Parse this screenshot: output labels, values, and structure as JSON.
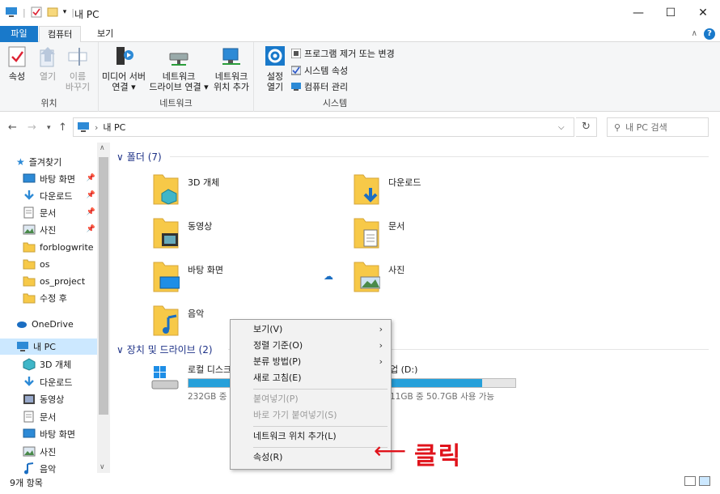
{
  "window": {
    "title": "내 PC"
  },
  "tabs": {
    "file": "파일",
    "computer": "컴퓨터",
    "view": "보기"
  },
  "ribbon": {
    "location": {
      "properties": "속성",
      "open": "열기",
      "rename_line1": "이름",
      "rename_line2": "바꾸기",
      "group": "위치"
    },
    "network": {
      "media_line1": "미디어 서버",
      "media_line2": "연결 ▾",
      "map_line1": "네트워크",
      "map_line2": "드라이브 연결 ▾",
      "add_line1": "네트워크",
      "add_line2": "위치 추가",
      "group": "네트워크"
    },
    "system": {
      "settings_line1": "설정",
      "settings_line2": "열기",
      "uninstall": "프로그램 제거 또는 변경",
      "sysprops": "시스템 속성",
      "manage": "컴퓨터 관리",
      "group": "시스템"
    }
  },
  "address": {
    "path": "내 PC",
    "search_placeholder": "내 PC 검색"
  },
  "nav": {
    "quick_access": "즐겨찾기",
    "items": [
      "바탕 화면",
      "다운로드",
      "문서",
      "사진",
      "forblogwrite",
      "os",
      "os_project",
      "수정 후"
    ],
    "onedrive": "OneDrive",
    "thispc": "내 PC",
    "pc_items": [
      "3D 개체",
      "다운로드",
      "동영상",
      "문서",
      "바탕 화면",
      "사진",
      "음악"
    ]
  },
  "content": {
    "folders_header": "폴더 (7)",
    "folders": [
      "3D 개체",
      "다운로드",
      "동영상",
      "문서",
      "바탕 화면",
      "사진",
      "음악"
    ],
    "drives_header": "장치 및 드라이브 (2)",
    "drive_c": {
      "name": "로컬 디스크",
      "sub": "232GB 중 2",
      "fill": 0.5
    },
    "drive_d": {
      "name": "업 (D:)",
      "sub": "11GB 중 50.7GB 사용 가능",
      "fill": 0.8
    }
  },
  "context_menu": {
    "view": "보기(V)",
    "sort": "정렬 기준(O)",
    "group": "분류 방법(P)",
    "refresh": "새로 고침(E)",
    "paste": "붙여넣기(P)",
    "paste_shortcut": "바로 가기 붙여넣기(S)",
    "add_network": "네트워크 위치 추가(L)",
    "properties": "속성(R)"
  },
  "annotation": {
    "text": "클릭"
  },
  "status": {
    "count": "9개 항목"
  },
  "colors": {
    "accent": "#1979ca",
    "selection": "#cce8ff",
    "annotation": "#e0131b",
    "folder": "#f7c948"
  }
}
